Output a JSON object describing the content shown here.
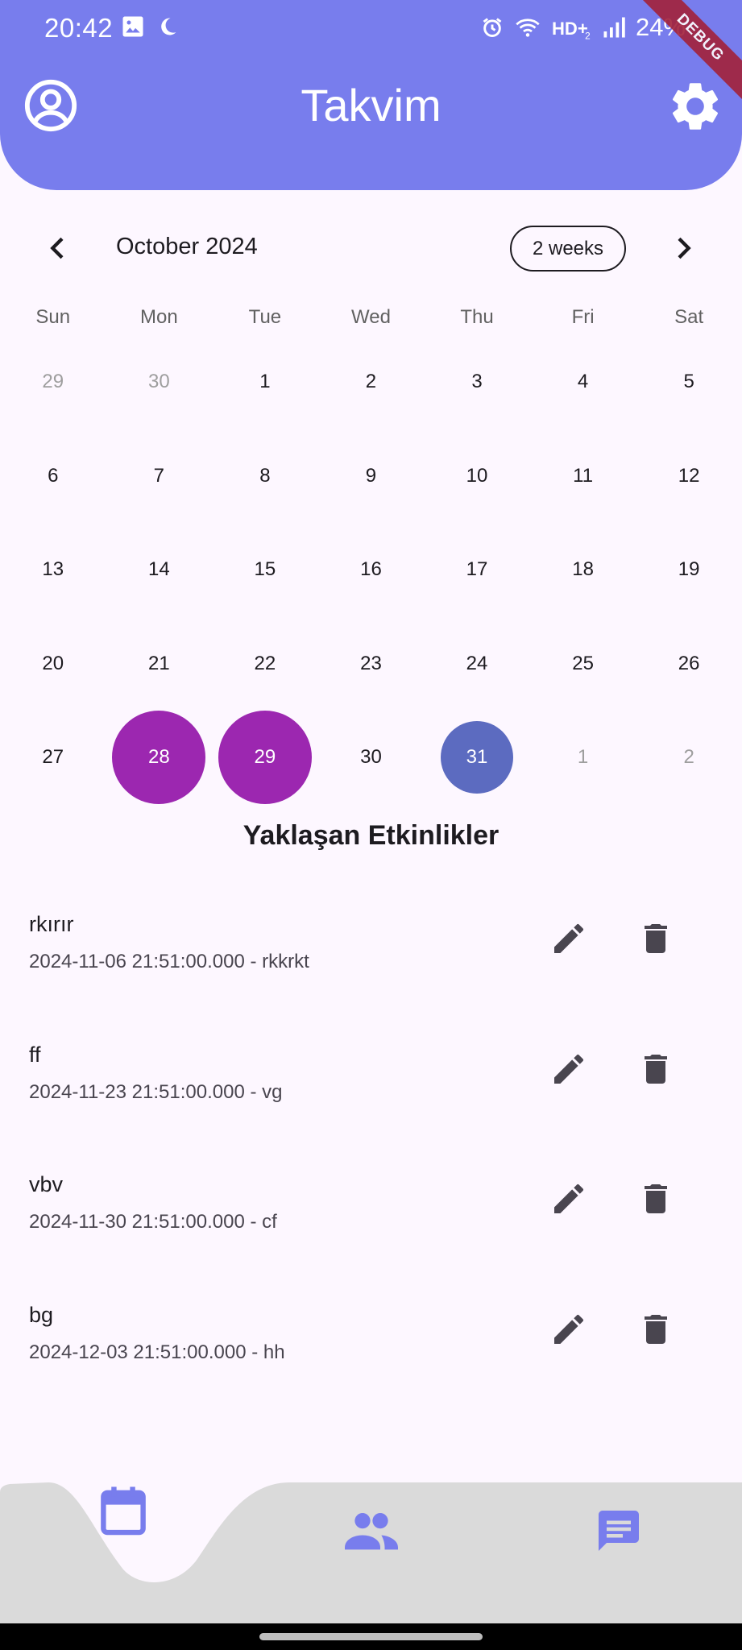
{
  "status_bar": {
    "time": "20:42",
    "battery": "24%",
    "debug_label": "DEBUG",
    "icons_left": [
      "gallery-icon",
      "moon-icon"
    ],
    "icons_right": [
      "alarm-icon",
      "wifi-icon",
      "hd-voice-icon",
      "signal-icon"
    ]
  },
  "header": {
    "title": "Takvim",
    "color": "#787ded",
    "left_icon": "account-circle-icon",
    "right_icon": "settings-icon"
  },
  "calendar": {
    "month_title": "October 2024",
    "format_button": "2 weeks",
    "days_of_week": [
      "Sun",
      "Mon",
      "Tue",
      "Wed",
      "Thu",
      "Fri",
      "Sat"
    ],
    "weeks": [
      [
        {
          "d": "29",
          "outside": true
        },
        {
          "d": "30",
          "outside": true
        },
        {
          "d": "1"
        },
        {
          "d": "2"
        },
        {
          "d": "3"
        },
        {
          "d": "4"
        },
        {
          "d": "5"
        }
      ],
      [
        {
          "d": "6"
        },
        {
          "d": "7"
        },
        {
          "d": "8"
        },
        {
          "d": "9"
        },
        {
          "d": "10"
        },
        {
          "d": "11"
        },
        {
          "d": "12"
        }
      ],
      [
        {
          "d": "13"
        },
        {
          "d": "14"
        },
        {
          "d": "15"
        },
        {
          "d": "16"
        },
        {
          "d": "17"
        },
        {
          "d": "18"
        },
        {
          "d": "19"
        }
      ],
      [
        {
          "d": "20"
        },
        {
          "d": "21"
        },
        {
          "d": "22"
        },
        {
          "d": "23"
        },
        {
          "d": "24"
        },
        {
          "d": "25"
        },
        {
          "d": "26"
        }
      ],
      [
        {
          "d": "27"
        },
        {
          "d": "28",
          "marked": true
        },
        {
          "d": "29",
          "marked": true
        },
        {
          "d": "30"
        },
        {
          "d": "31",
          "today": true
        },
        {
          "d": "1",
          "outside": true
        },
        {
          "d": "2",
          "outside": true
        }
      ]
    ],
    "marked_color": "#9c27b0",
    "today_color": "#5c6bc0"
  },
  "events_section": {
    "title": "Yaklaşan Etkinlikler",
    "items": [
      {
        "title": "rkırır",
        "subtitle": "2024-11-06 21:51:00.000 - rkkrkt"
      },
      {
        "title": "ff",
        "subtitle": "2024-11-23 21:51:00.000 - vg"
      },
      {
        "title": "vbv",
        "subtitle": "2024-11-30 21:51:00.000 - cf"
      },
      {
        "title": "bg",
        "subtitle": "2024-12-03 21:51:00.000 - hh"
      }
    ]
  },
  "bottom_nav": {
    "items": [
      "calendar-icon",
      "people-icon",
      "chat-icon"
    ],
    "active_index": 0,
    "bar_color": "#dadada",
    "icon_color": "#787ded"
  }
}
